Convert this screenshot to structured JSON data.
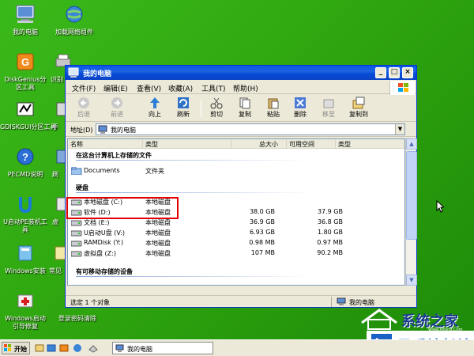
{
  "desktop": {
    "icons": [
      {
        "label": "我的电脑"
      },
      {
        "label": "加载网络组件"
      },
      {
        "label": "DiskGenius分区工具"
      },
      {
        "label": "识别"
      },
      {
        "label": "GDISKGUI分区工具"
      },
      {
        "label": "手"
      },
      {
        "label": "PECMD说明"
      },
      {
        "label": "刷"
      },
      {
        "label": "U启动PE装机工具"
      },
      {
        "label": "虚"
      },
      {
        "label": "Windows安装"
      },
      {
        "label": "常见"
      },
      {
        "label": "Windows启动引导修复"
      },
      {
        "label": "登录密码清除"
      }
    ]
  },
  "window": {
    "title": "我的电脑",
    "controls": {
      "minimize": "_",
      "maximize": "□",
      "close": "×"
    },
    "menu": [
      "文件(F)",
      "编辑(E)",
      "查看(V)",
      "收藏(A)",
      "工具(T)",
      "帮助(H)"
    ],
    "toolbar": [
      {
        "label": "后退",
        "icon": "back-arrow"
      },
      {
        "label": "前进",
        "icon": "forward-arrow"
      },
      {
        "label": "向上",
        "icon": "up-arrow"
      },
      {
        "label": "刷新",
        "icon": "refresh"
      },
      {
        "label": "剪切",
        "icon": "scissors"
      },
      {
        "label": "复制",
        "icon": "copy"
      },
      {
        "label": "粘贴",
        "icon": "paste"
      },
      {
        "label": "删除",
        "icon": "delete-x"
      },
      {
        "label": "移至",
        "icon": "move-to"
      },
      {
        "label": "复制到",
        "icon": "copy-to"
      }
    ],
    "address": {
      "label": "地址(D)",
      "value": "我的电脑"
    },
    "columns": [
      "名称",
      "类型",
      "总大小",
      "可用空间",
      "类型"
    ],
    "group_files": "在这台计算机上存储的文件",
    "group_drives": "硬盘",
    "group_removable": "有可移动存储的设备",
    "files": [
      {
        "name": "Documents",
        "type": "文件夹",
        "total": "",
        "free": ""
      }
    ],
    "drives": [
      {
        "name": "本地磁盘 (C:)",
        "type": "本地磁盘",
        "total": "",
        "free": ""
      },
      {
        "name": "软件 (D:)",
        "type": "本地磁盘",
        "total": "38.0 GB",
        "free": "37.9 GB"
      },
      {
        "name": "文档 (E:)",
        "type": "本地磁盘",
        "total": "36.9 GB",
        "free": "36.8 GB"
      },
      {
        "name": "U启动U盘 (V:)",
        "type": "本地磁盘",
        "total": "6.93 GB",
        "free": "1.80 GB"
      },
      {
        "name": "RAMDisk (Y:)",
        "type": "本地磁盘",
        "total": "0.98 MB",
        "free": "0.97 MB"
      },
      {
        "name": "虚拟盘 (Z:)",
        "type": "本地磁盘",
        "total": "107 MB",
        "free": "90.2 MB"
      }
    ],
    "status": {
      "left": "选定 1 个对象",
      "right": "我的电脑"
    }
  },
  "taskbar": {
    "start": "开始",
    "task": "我的电脑"
  },
  "watermark": {
    "site1": "系统之家",
    "site1_url": "Www.Xitong.Com",
    "site2": "易采站长站"
  },
  "colors": {
    "desktop": "#2fa80f",
    "titlebar": "#0a58e7",
    "highlight": "#e00000"
  }
}
